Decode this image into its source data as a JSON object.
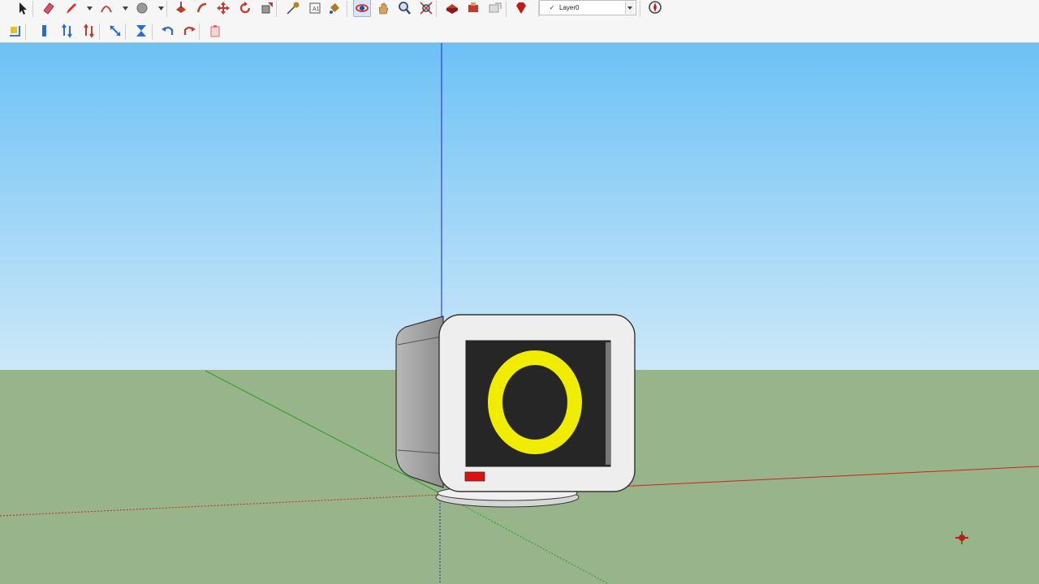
{
  "toolbar": {
    "row1": [
      {
        "name": "select-icon",
        "color": "#222222"
      },
      {
        "name": "eraser-icon",
        "color": "#e0506a"
      },
      {
        "name": "pencil-icon",
        "color": "#d23030"
      },
      {
        "name": "arc-icon",
        "color": "#d23030"
      },
      {
        "name": "circle-shape-icon",
        "color": "#9a9a9a"
      },
      {
        "name": "push-pull-icon",
        "color": "#c23a2a"
      },
      {
        "name": "follow-me-icon",
        "color": "#c23a2a"
      },
      {
        "name": "move-icon",
        "color": "#c23a2a"
      },
      {
        "name": "rotate-icon",
        "color": "#c23a2a"
      },
      {
        "name": "scale-icon",
        "color": "#c23a2a"
      },
      {
        "name": "tape-measure-icon",
        "color": "#b08a20"
      },
      {
        "name": "text-icon",
        "color": "#555555"
      },
      {
        "name": "paint-bucket-icon",
        "color": "#b07a20"
      },
      {
        "name": "orbit-icon",
        "color": "#c23a2a"
      },
      {
        "name": "pan-icon",
        "color": "#d4a060"
      },
      {
        "name": "zoom-icon",
        "color": "#2a4a7a"
      },
      {
        "name": "zoom-extents-icon",
        "color": "#c23a2a"
      },
      {
        "name": "warehouse-icon",
        "color": "#c23a2a"
      },
      {
        "name": "extension-warehouse-icon",
        "color": "#c23a2a"
      },
      {
        "name": "share-model-icon",
        "color": "#9a9a9a"
      },
      {
        "name": "ruby-icon",
        "color": "#c21a1a"
      }
    ],
    "row2": [
      {
        "name": "axes-view-icon",
        "color": "#2a7ad6"
      },
      {
        "name": "section-icon",
        "color": "#2a6ad6"
      },
      {
        "name": "flip-along-icon",
        "color": "#2a6ad6"
      },
      {
        "name": "flip-across-icon",
        "color": "#c23a2a"
      },
      {
        "name": "diagonal-move-icon",
        "color": "#2a6ad6"
      },
      {
        "name": "hourglass-icon",
        "color": "#2a6ad6"
      },
      {
        "name": "undo-icon",
        "color": "#2a6ad6"
      },
      {
        "name": "redo-icon",
        "color": "#c23a2a"
      },
      {
        "name": "paste-icon",
        "color": "#d07070"
      }
    ],
    "layer": {
      "check": "✓",
      "name": "Layer0"
    }
  },
  "scene": {
    "sky_top": "#6cc1f5",
    "sky_bottom": "#cde8f8",
    "ground": "#98b48a",
    "axis_red": "#d02020",
    "axis_green": "#20a020",
    "axis_blue": "#2020c0",
    "screen": "#262626",
    "ring": "#f0ec00",
    "power_led": "#e01010",
    "casing": "#eeeeee"
  }
}
